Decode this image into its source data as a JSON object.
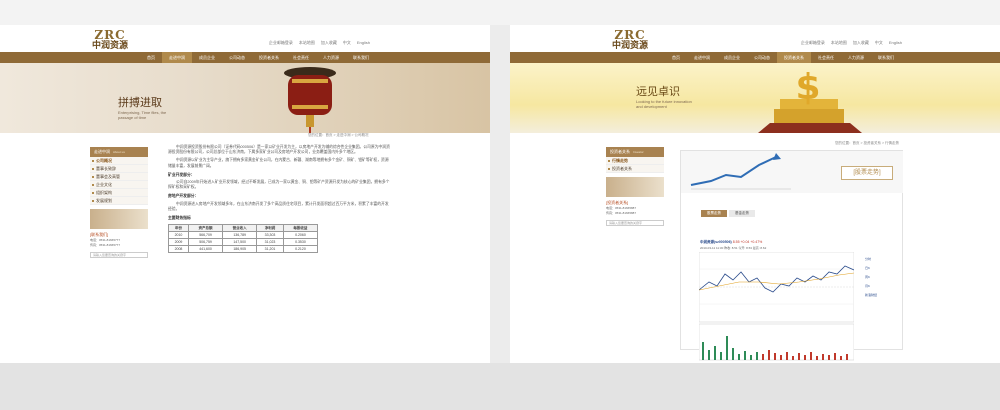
{
  "left": {
    "logo": {
      "mark": "ZRC",
      "cn": "中润资源",
      "en": "ZHONGRUN RESOURCES"
    },
    "toplinks": [
      "企业邮箱登录",
      "本站地图",
      "加入收藏",
      "中文",
      "English"
    ],
    "nav": [
      "首页",
      "走进中润",
      "成员企业",
      "公司动态",
      "投资者关系",
      "社会责任",
      "人力资源",
      "联系我们"
    ],
    "nav_active": 1,
    "banner": {
      "title": "拼搏进取",
      "sub": "Enterprising, Time flies, the passage of time"
    },
    "sidebar": {
      "head": "走进中润",
      "head_en": "About us",
      "items": [
        "公司概况",
        "董事长致辞",
        "董事会及高管",
        "企业文化",
        "组织架构",
        "发展规划"
      ],
      "selected": 0,
      "contact_title": "[联系我们]",
      "contact_lines": [
        "电话：0531-81665777",
        "传真：0531-81665777"
      ],
      "search_placeholder": "请输入您要查询的关键字"
    },
    "breadcrumb": "您的位置：首页 > 走进中润 > 公司概况",
    "content": {
      "p1": "中润资源投资股份有限公司（证券代码000506）是一家以矿业开发为主，以房地产开发为辅的综合性企业集团。公司原为中润资源投资股份有限公司，公司总部位于山东济南，下属多家矿业公司及房地产开发公司，业务覆盖国内外多个地区。",
      "p2": "中润资源以矿业为主导产业，旗下拥有多家黄金矿业公司，在内蒙古、新疆、湖南等地拥有多个金矿、铜矿、钼矿等矿权，资源储量丰富，发展前景广阔。",
      "h1": "矿业开发部分：",
      "p3": "公司自2009年开始进入矿业开发领域，经过不断发展，已成为一家以黄金、铜、钼等矿产资源开发为核心的矿业集团，拥有多个探矿权和采矿权。",
      "h2": "房地产开发部分：",
      "p4": "中润资源进入房地产开发领域多年，在山东济南开发了多个高品质住宅项目，累计开发面积超过百万平方米，积累了丰富的开发经验。",
      "table_title": "主要财务指标",
      "table_headers": [
        "年份",
        "资产总额",
        "营业收入",
        "净利润",
        "每股收益"
      ],
      "table_rows": [
        [
          "2010",
          "566,709",
          "136,789",
          "33,303",
          "0.2060"
        ],
        [
          "2009",
          "506,759",
          "147,500",
          "31,023",
          "0.3530"
        ],
        [
          "2008",
          "441,600",
          "186,905",
          "31,201",
          "0.2120"
        ]
      ]
    }
  },
  "right": {
    "logo": {
      "mark": "ZRC",
      "cn": "中润资源",
      "en": "ZHONGRUN RESOURCES"
    },
    "toplinks": [
      "企业邮箱登录",
      "本站地图",
      "加入收藏",
      "中文",
      "English"
    ],
    "nav": [
      "首页",
      "走进中润",
      "成员企业",
      "公司动态",
      "投资者关系",
      "社会责任",
      "人力资源",
      "联系我们"
    ],
    "nav_active": 4,
    "banner": {
      "title": "远见卓识",
      "sub": "Looking to the future innovation and development"
    },
    "sidebar": {
      "head": "投资者关系",
      "head_en": "Investor",
      "items": [
        "行情走势",
        "投资者关系"
      ],
      "selected": 0,
      "contact_title": "[投资者关系]",
      "contact_lines": [
        "电话：0531-81665887",
        "传真：0531-81665887"
      ],
      "search_placeholder": "请输入您要查询的关键字"
    },
    "breadcrumb": "您的位置：首页 > 投资者关系 > 行情走势",
    "stock": {
      "tag": "[股票走势]",
      "tabs": [
        "股票走势",
        "基金走势"
      ],
      "ticker_name": "中润资源(sz000506)",
      "ticker_values": "8.55  +0.04  +0.47%",
      "ticker_time": "2010-03-11 11:30   昨收: 8.51   今开: 8.53   最高: 8.62",
      "links": [
        "分时",
        "日K",
        "周K",
        "月K",
        "新浪财经"
      ]
    }
  }
}
